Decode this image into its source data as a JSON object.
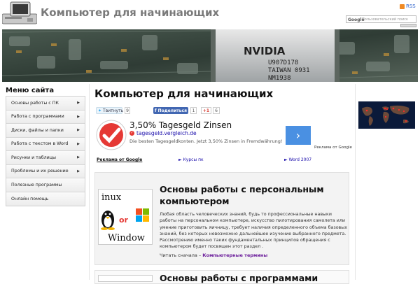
{
  "header": {
    "site_title": "Компьютер для начинающих",
    "rss_label": "RSS",
    "search_brand": "Google",
    "search_placeholder": "Пользовательский поиск"
  },
  "banner": {
    "chip_brand": "NVIDIA",
    "chip_line1": "U907D178",
    "chip_line2": "TAIWAN 0931",
    "chip_line3": "NM1938"
  },
  "sidebar": {
    "title": "Меню сайта",
    "items": [
      {
        "label": "Основы работы с ПК",
        "has_arrow": true
      },
      {
        "label": "Работа с программами",
        "has_arrow": true
      },
      {
        "label": "Диски, файлы и папки",
        "has_arrow": true
      },
      {
        "label": "Работа с текстом в Word",
        "has_arrow": true
      },
      {
        "label": "Рисунки и таблицы",
        "has_arrow": true
      },
      {
        "label": "Проблемы и их решение",
        "has_arrow": true
      },
      {
        "label": "Полезные программы",
        "has_arrow": false
      },
      {
        "label": "Онлайн помощь",
        "has_arrow": false
      }
    ]
  },
  "main": {
    "heading": "Компьютер для начинающих",
    "share": {
      "twitter_label": "Твитнуть",
      "twitter_count": "9",
      "facebook_label": "Поделиться",
      "facebook_count": "1",
      "gplus_label": "+1",
      "gplus_count": "6"
    },
    "ad": {
      "title": "3,50% Tagesgeld Zinsen",
      "url": "tagesgeld.vergleich.de",
      "description": "Die besten Tagesgeldkonten. Jetzt 3,50% Zinsen in Fremdwährung!",
      "arrow": "›",
      "choices": "Реклама от Google"
    },
    "link_units": {
      "ads_label": "Реклама от Google",
      "link1": "► Курсы пк",
      "link2": "► Word 2007"
    },
    "article": {
      "title": "Основы работы с персональным компьютером",
      "text": "Любая область человеческих знаний, будь то профессиональные навыки работы на персональном компьютере, искусство пилотирования самолета или умение приготовить яичницу, требует наличия определенного объема базовых знаний, без которых невозможно дальнейшее изучение выбранного предмета. Рассмотрению именно таких фундаментальных принципов обращения с компьютером будет посвящен этот раздел .",
      "read_first_label": "Читать сначала –",
      "read_first_link": "Компьютерные термины",
      "image_words": [
        "inux",
        "or",
        "Window"
      ]
    },
    "article2": {
      "title": "Основы работы с программами"
    }
  },
  "colors": {
    "title_gray": "#7a7a7a",
    "link_blue": "#1a0dab",
    "facebook_blue": "#4267b2",
    "ad_arrow_blue": "#4a90e2"
  }
}
